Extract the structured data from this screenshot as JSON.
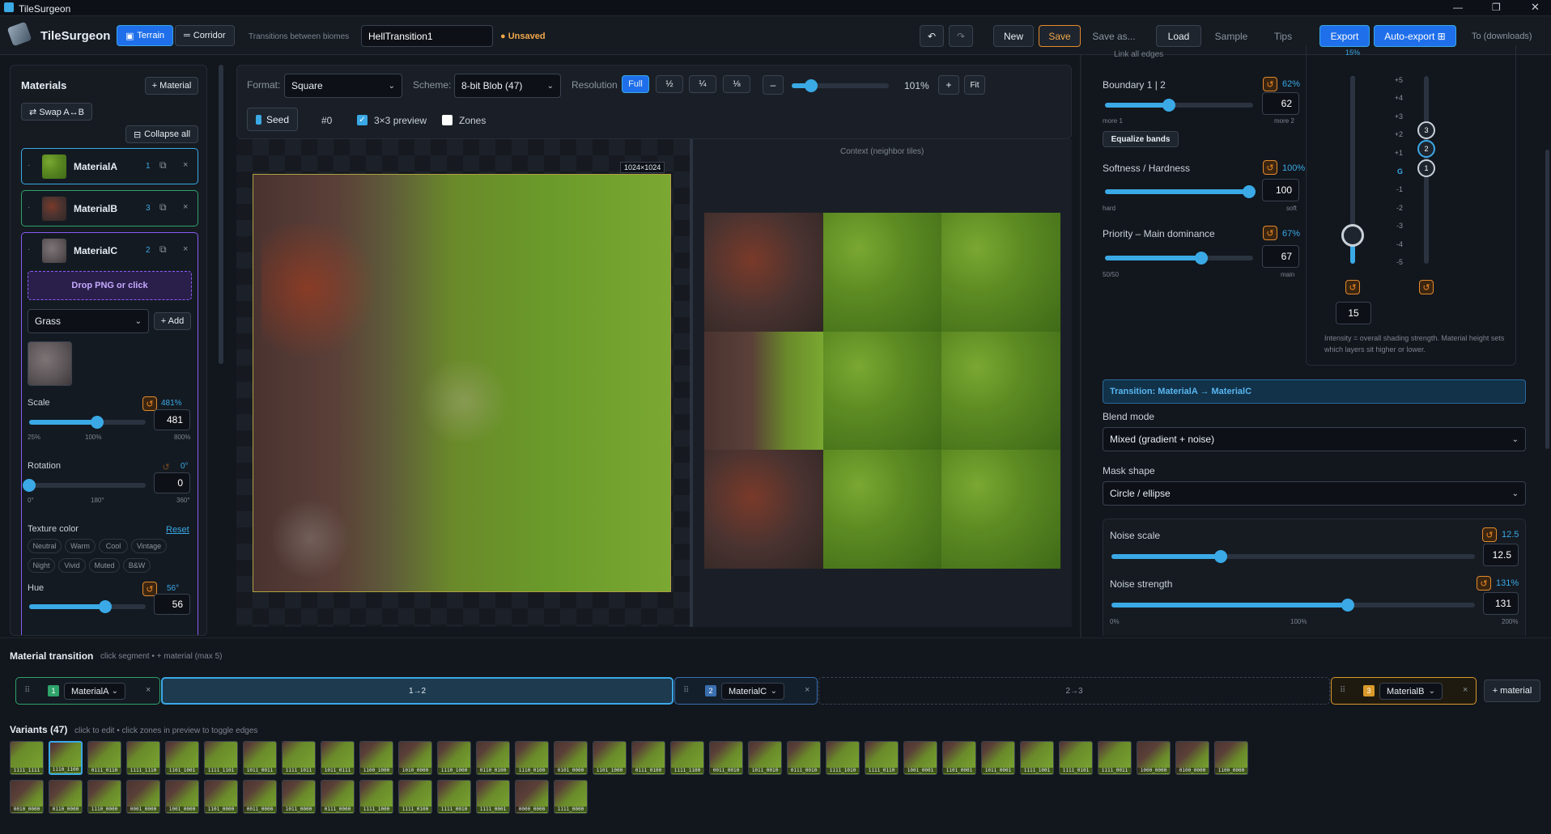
{
  "titlebar": {
    "title": "TileSurgeon"
  },
  "toolbar": {
    "brand": "TileSurgeon",
    "mode_terrain": "Terrain",
    "mode_corridor": "Corridor",
    "subtitle": "Transitions between biomes",
    "project_name": "HellTransition1",
    "status": "● Unsaved",
    "new": "New",
    "save": "Save",
    "save_as": "Save as...",
    "load": "Load",
    "sample": "Sample",
    "tips": "Tips",
    "export": "Export",
    "auto_export": "Auto-export ⊞",
    "target": "To (downloads)"
  },
  "materials": {
    "heading": "Materials",
    "add": "+ Material",
    "swap": "⇄ Swap A↔B",
    "collapse": "Collapse all",
    "items": [
      {
        "name": "MaterialA",
        "index": "1"
      },
      {
        "name": "MaterialB",
        "index": "3"
      },
      {
        "name": "MaterialC",
        "index": "2"
      }
    ],
    "drop": "Drop PNG or click",
    "texture_select": "Grass",
    "add_btn": "+ Add",
    "scale_label": "Scale",
    "scale_pct": "481%",
    "scale_value": "481",
    "scale_ticks": [
      "25%",
      "100%",
      "800%"
    ],
    "scale_level": 0.58,
    "rotation_label": "Rotation",
    "rotation_pct": "0°",
    "rotation_value": "0",
    "rotation_ticks": [
      "0°",
      "180°",
      "360°"
    ],
    "rotation_level": 0.0,
    "texcolor_label": "Texture color",
    "texcolor_reset": "Reset",
    "chips_row1": [
      "Neutral",
      "Warm",
      "Cool",
      "Vintage"
    ],
    "chips_row2": [
      "Night",
      "Vivid",
      "Muted",
      "B&W"
    ],
    "hue_label": "Hue",
    "hue_pct": "56°",
    "hue_value": "56",
    "hue_level": 0.65
  },
  "preview": {
    "format_label": "Format:",
    "format_value": "Square",
    "scheme_label": "Scheme:",
    "scheme_value": "8-bit Blob (47)",
    "resolution_label": "Resolution",
    "res_options": [
      "Full",
      "½",
      "¼",
      "⅛"
    ],
    "zoom_minus": "–",
    "zoom_value": "101%",
    "zoom_plus": "+",
    "zoom_fit": "Fit",
    "zoom_level": 0.2,
    "seed": "Seed",
    "seed_num": "#0",
    "preview3": "3×3 preview",
    "zones": "Zones",
    "size_badge": "1024×1024",
    "context_label": "Context (neighbor tiles)"
  },
  "right": {
    "link_edges": "Link all edges",
    "boundary_label": "Boundary 1 | 2",
    "boundary_pct": "62%",
    "boundary_value": "62",
    "boundary_level": 0.43,
    "boundary_ticks": [
      "more 1",
      "more 2"
    ],
    "equalize": "Equalize bands",
    "softness_label": "Softness / Hardness",
    "softness_pct": "100%",
    "softness_value": "100",
    "softness_level": 0.97,
    "softness_ticks": [
      "hard",
      "soft"
    ],
    "priority_label": "Priority – Main dominance",
    "priority_pct": "67%",
    "priority_value": "67",
    "priority_level": 0.65,
    "priority_ticks": [
      "50/50",
      "main"
    ],
    "height_ticks": [
      "+5",
      "+4",
      "+3",
      "+2",
      "+1",
      "G",
      "-1",
      "-2",
      "-3",
      "-4",
      "-5"
    ],
    "height_badges": [
      "3",
      "2",
      "1"
    ],
    "top_pct": "15%",
    "intensity_value": "15",
    "intensity_level": 0.15,
    "intensity_note": "Intensity = overall shading strength. Material height sets which layers sit higher or lower.",
    "transition_title": "Transition: MaterialA → MaterialC",
    "blend_label": "Blend mode",
    "blend_value": "Mixed (gradient + noise)",
    "mask_label": "Mask shape",
    "mask_value": "Circle / ellipse",
    "noise_scale_label": "Noise scale",
    "noise_scale_pct": "12.5",
    "noise_scale_value": "12.5",
    "noise_scale_level": 0.3,
    "noise_strength_label": "Noise strength",
    "noise_strength_pct": "131%",
    "noise_strength_value": "131",
    "noise_strength_level": 0.65,
    "noise_ticks": [
      "0%",
      "100%",
      "200%"
    ]
  },
  "transition": {
    "heading": "Material transition",
    "hint": "click segment • + material (max 5)",
    "segA": {
      "index": "1",
      "name": "MaterialA"
    },
    "seg12": "1→2",
    "segC": {
      "index": "2",
      "name": "MaterialC"
    },
    "seg23": "2→3",
    "segB": {
      "index": "3",
      "name": "MaterialB"
    },
    "add": "+ material"
  },
  "variants": {
    "heading": "Variants (47)",
    "hint": "click to edit • click zones in preview to toggle edges",
    "row1": [
      "1111_1111",
      "1110_1100",
      "0111_0110",
      "1111_1110",
      "1101_1001",
      "1111_1101",
      "1011_0011",
      "1111_1011",
      "1011_0111",
      "1100_1000",
      "1010_0000",
      "1110_1000",
      "0110_0100",
      "1110_0100",
      "0101_0000",
      "1101_1000",
      "0111_0100",
      "1111_1100",
      "0011_0010",
      "1011_0010",
      "0111_0010",
      "1111_1010",
      "1111_0110",
      "1001_0001",
      "1101_0001",
      "1011_0001",
      "1111_1001",
      "1111_0101",
      "1111_0011",
      "1000_0000",
      "0100_0000",
      "1100_0000"
    ],
    "row2": [
      "0010_0000",
      "0110_0000",
      "1110_0000",
      "0001_0000",
      "1001_0000",
      "1101_0000",
      "0011_0000",
      "1011_0000",
      "0111_0000",
      "1111_1000",
      "1111_0100",
      "1111_0010",
      "1111_0001",
      "0000_0000",
      "1111_0000"
    ]
  }
}
